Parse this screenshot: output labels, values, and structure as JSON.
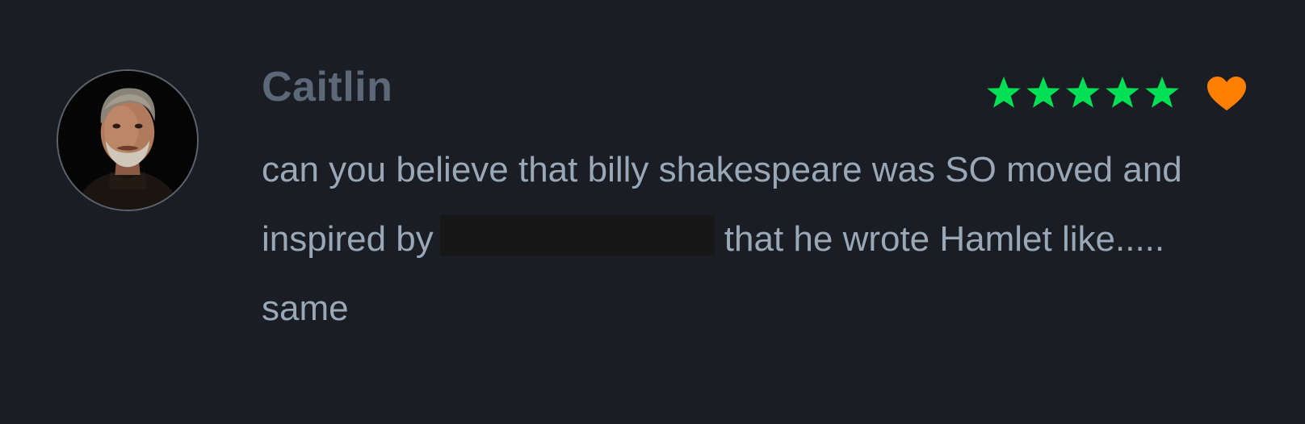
{
  "review": {
    "author": "Caitlin",
    "avatar_alt": "avatar",
    "rating": 5,
    "rating_max": 5,
    "liked": true,
    "text_before": "can you believe that billy shakespeare was SO moved and inspired by",
    "text_after": "that he wrote Hamlet like..... same"
  },
  "colors": {
    "background": "#1a1d23",
    "username": "#5c6877",
    "text": "#9aa7b6",
    "star": "#00e054",
    "heart": "#ff8000",
    "redaction": "#171717"
  },
  "icons": {
    "star": "star-icon",
    "like": "heart-icon"
  }
}
